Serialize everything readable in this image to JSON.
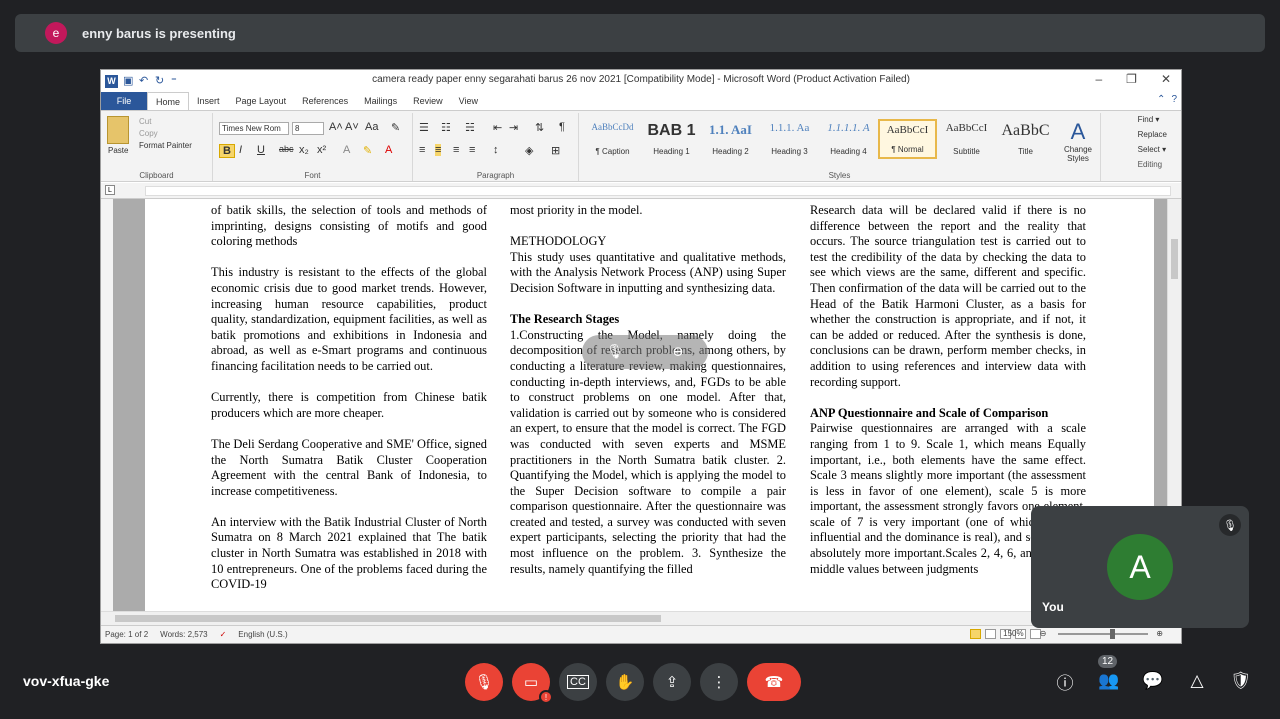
{
  "presenter": {
    "initial": "e",
    "text": "enny barus is presenting"
  },
  "window": {
    "title": "camera ready paper enny segarahati barus 26 nov 2021 [Compatibility Mode] - Microsoft Word (Product Activation Failed)",
    "controls": {
      "minimize": "–",
      "restore": "❐",
      "close": "✕"
    }
  },
  "ribbon": {
    "tabs": [
      "File",
      "Home",
      "Insert",
      "Page Layout",
      "References",
      "Mailings",
      "Review",
      "View"
    ],
    "clipboard": {
      "paste": "Paste",
      "cut": "Cut",
      "copy": "Copy",
      "format_painter": "Format Painter",
      "label": "Clipboard"
    },
    "font": {
      "name": "Times New Rom",
      "size": "8",
      "label": "Font"
    },
    "paragraph": {
      "label": "Paragraph"
    },
    "styles": {
      "label": "Styles",
      "items": [
        {
          "sample": "AaBbCcDd",
          "name": "¶ Caption",
          "color": "#4f81bd"
        },
        {
          "sample": "BAB 1",
          "name": "Heading 1",
          "color": "#000000"
        },
        {
          "sample": "1.1. AaI",
          "name": "Heading 2",
          "color": "#4f81bd"
        },
        {
          "sample": "1.1.1. Aa",
          "name": "Heading 3",
          "color": "#4f81bd"
        },
        {
          "sample": "1.1.1.1. A",
          "name": "Heading 4",
          "color": "#4f81bd"
        },
        {
          "sample": "AaBbCcI",
          "name": "¶ Normal",
          "color": "#000000"
        },
        {
          "sample": "AaBbCcI",
          "name": "Subtitle",
          "color": "#000000"
        },
        {
          "sample": "AaBbC",
          "name": "Title",
          "color": "#000000"
        }
      ],
      "change_styles": "Change Styles"
    },
    "editing": {
      "find": "Find ▾",
      "replace": "Replace",
      "select": "Select ▾",
      "label": "Editing"
    }
  },
  "document": {
    "col1": [
      "of batik skills, the selection of tools and methods of imprinting, designs consisting of motifs and good coloring methods",
      "This industry is resistant to the effects of the global economic crisis due to good market trends. However, increasing human resource capabilities, product quality, standardization, equipment facilities, as well as batik promotions and exhibitions in Indonesia and abroad, as well as e-Smart programs and continuous financing facilitation needs to be carried out.",
      "Currently, there is competition from Chinese batik producers which are more cheaper.",
      "The Deli Serdang Cooperative and SME' Office, signed the North Sumatra Batik Cluster Cooperation Agreement with the central Bank of Indonesia, to increase competitiveness.",
      "An interview with the Batik Industrial Cluster of North Sumatra on 8 March 2021 explained that The batik cluster in North Sumatra was established in 2018 with 10 entrepreneurs. One of the problems faced during the COVID-19"
    ],
    "col2_top": "most priority in the model.",
    "col2_heading": "METHODOLOGY",
    "col2_para1": "This study uses quantitative and qualitative methods, with the Analysis Network Process (ANP) using Super Decision Software in inputting and synthesizing data.",
    "col2_heading2": "The Research Stages",
    "col2_para2": "1.Constructing the Model, namely doing the decomposition of research problems, among others, by conducting a literature review, making questionnaires, conducting in-depth interviews, and, FGDs to be able to construct problems on one model. After that, validation is carried out by someone who is considered an expert, to ensure that the model is correct. The FGD was conducted with seven experts and MSME practitioners in the North Sumatra batik cluster. 2. Quantifying the Model, which is applying the model to the Super Decision software to compile a pair comparison questionnaire. After the questionnaire was created and tested, a survey was conducted with seven expert participants, selecting the priority that had the most influence on the problem. 3. Synthesize the results, namely quantifying the filled",
    "col3_para1": "Research data will be declared valid if there is no difference between the report and the reality that occurs. The source triangulation test is carried out to test the credibility of the data by checking the data to see which views are the same, different and specific. Then confirmation of the data will be carried out to the Head of the Batik Harmoni Cluster, as a basis for whether the construction is appropriate, and if not, it can be added or reduced. After the synthesis is done, conclusions can be drawn, perform member checks, in addition to using references and interview data with recording support.",
    "col3_heading": "ANP Questionnaire and Scale of Comparison",
    "col3_para2": "Pairwise questionnaires are arranged with a scale ranging from 1 to 9. Scale 1, which means Equally important, i.e., both elements have the same effect. Scale 3 means slightly more important (the assessment is less in favor of one element), scale 5 is more important, the assessment strongly favors one element, scale of 7 is very important (one of which is more influential and the dominance is real), and scale of 9 is absolutely more important.Scales 2, 4, 6, and 8 are the middle values between judgments"
  },
  "statusbar": {
    "page": "Page: 1 of 2",
    "words": "Words: 2,573",
    "language": "English (U.S.)",
    "zoom": "150%",
    "zoom_level": 150
  },
  "self_tile": {
    "initial": "A",
    "label": "You"
  },
  "meeting": {
    "code": "vov-xfua-gke",
    "participants": "12"
  }
}
